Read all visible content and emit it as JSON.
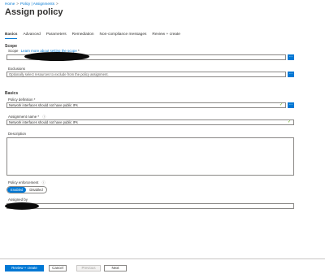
{
  "breadcrumb": [
    "Home",
    "Policy | Assignments"
  ],
  "breadcrumb_separator": ">",
  "page_title": "Assign policy",
  "more_menu": "...",
  "tabs": [
    "Basics",
    "Advanced",
    "Parameters",
    "Remediation",
    "Non-compliance messages",
    "Review + create"
  ],
  "scope": {
    "section_title": "Scope",
    "label": "Scope",
    "help_link": "Learn more about setting the scope",
    "required": "*",
    "browse": "..."
  },
  "exclusions": {
    "label": "Exclusions",
    "placeholder": "Optionally select resources to exclude from the policy assignment.",
    "browse": "..."
  },
  "basics": {
    "section_title": "Basics",
    "policy_definition_label": "Policy definition *",
    "policy_definition_value": "Network interfaces should not have public IPs",
    "assignment_name_label": "Assignment name *",
    "info_icon": "ⓘ",
    "assignment_name_value": "Network interfaces should not have public IPs",
    "description_label": "Description",
    "check": "✓"
  },
  "enforcement": {
    "label": "Policy enforcement",
    "options": [
      "Enabled",
      "Disabled"
    ],
    "selected": "Enabled"
  },
  "assigned_by": {
    "label": "Assigned by"
  },
  "footer": {
    "review_create": "Review + create",
    "cancel": "Cancel",
    "previous": "Previous",
    "next": "Next"
  }
}
